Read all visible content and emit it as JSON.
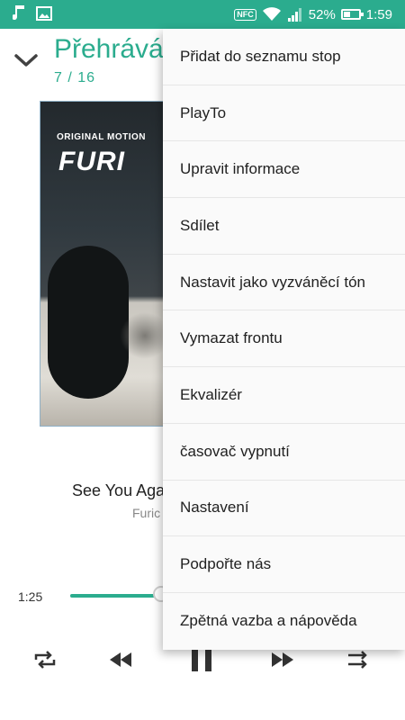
{
  "status_bar": {
    "icons_left": [
      "music-note-icon",
      "image-icon"
    ],
    "nfc_label": "NFC",
    "battery_percent": "52%",
    "battery_level": 0.52,
    "time": "1:59"
  },
  "header": {
    "title": "Přehrává",
    "track_counter": "7 / 16"
  },
  "album_art": {
    "tagline": "ORIGINAL MOTION",
    "title_partial": "FURI"
  },
  "song": {
    "title": "See You Aga",
    "artist": "Furic"
  },
  "playback": {
    "current_time": "1:25",
    "progress_fraction": 0.28
  },
  "controls": [
    "repeat-icon",
    "rewind-icon",
    "pause-icon",
    "fast-forward-icon",
    "queue-icon"
  ],
  "overflow_menu": {
    "items": [
      "Přidat do seznamu stop",
      "PlayTo",
      "Upravit informace",
      "Sdílet",
      "Nastavit jako vyzváněcí tón",
      "Vymazat frontu",
      "Ekvalizér",
      "časovač vypnutí",
      "Nastavení",
      "Podpořte nás",
      "Zpětná vazba a nápověda"
    ]
  },
  "colors": {
    "accent": "#2bac8e",
    "status_bar": "#2bac8e",
    "menu_background": "#fafafa"
  }
}
